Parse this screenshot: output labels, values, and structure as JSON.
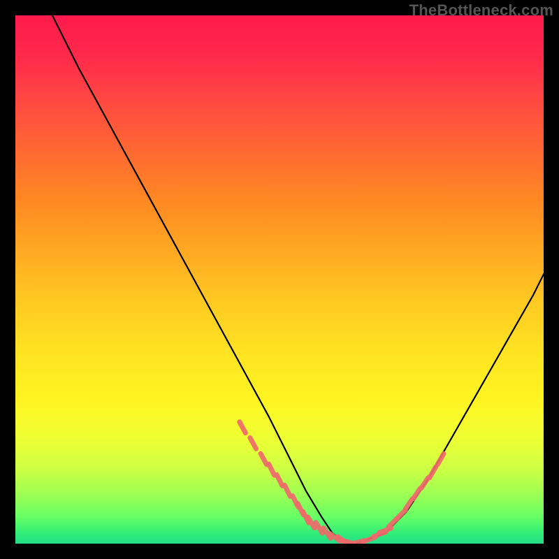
{
  "watermark": "TheBottleneck.com",
  "chart_data": {
    "type": "line",
    "title": "",
    "xlabel": "",
    "ylabel": "",
    "xlim": [
      0,
      100
    ],
    "ylim": [
      0,
      100
    ],
    "grid": false,
    "series": [
      {
        "name": "curve",
        "x": [
          7,
          12,
          18,
          24,
          30,
          36,
          42,
          48,
          52,
          55,
          58,
          60,
          62,
          64,
          66,
          70,
          74,
          78,
          82,
          86,
          90,
          94,
          98,
          100
        ],
        "y": [
          100,
          90,
          79,
          68,
          57,
          46,
          35,
          24,
          16,
          10,
          5,
          2,
          0.5,
          0,
          0.5,
          2,
          6,
          12,
          19,
          26,
          33,
          40,
          47,
          51
        ],
        "color": "#000000"
      }
    ],
    "overlays": [
      {
        "name": "tick-marks-left",
        "type": "scatter",
        "marker": "dash",
        "color": "#ef6b6b",
        "x": [
          43,
          45,
          47,
          48.5,
          50,
          51.5,
          53,
          54,
          55,
          56,
          57.5,
          59,
          60.5,
          62
        ],
        "y": [
          22,
          19,
          16,
          14,
          12,
          10,
          8,
          6.5,
          5,
          4,
          3,
          2,
          1.2,
          0.6
        ]
      },
      {
        "name": "tick-marks-bottom",
        "type": "scatter",
        "marker": "dash",
        "color": "#ef6b6b",
        "x": [
          63,
          65,
          67,
          69
        ],
        "y": [
          0.3,
          0.3,
          0.8,
          1.8
        ]
      },
      {
        "name": "tick-marks-right",
        "type": "scatter",
        "marker": "dash",
        "color": "#ef6b6b",
        "x": [
          70,
          71.5,
          73,
          74.5,
          76,
          77.5,
          79,
          80.5
        ],
        "y": [
          2.5,
          4,
          5.5,
          7.5,
          9.5,
          11.5,
          13.5,
          16
        ]
      }
    ],
    "background_gradient": {
      "direction": "top-to-bottom",
      "stops": [
        {
          "pos": 0.0,
          "color": "#ff1a4d"
        },
        {
          "pos": 0.5,
          "color": "#ffcc22"
        },
        {
          "pos": 0.85,
          "color": "#ccff44"
        },
        {
          "pos": 1.0,
          "color": "#22dd88"
        }
      ]
    }
  }
}
